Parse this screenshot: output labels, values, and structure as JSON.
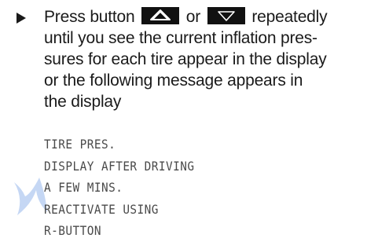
{
  "instruction": {
    "line1_before": "Press button",
    "line1_between": "or",
    "line1_after": "repeatedly",
    "lines": [
      "until you see the current inflation pres-",
      "sures for each tire appear in the display",
      "or the following message appears in",
      "the display"
    ],
    "up_key_icon": "up-arrow-key-icon",
    "down_key_icon": "down-arrow-key-icon"
  },
  "display_message": [
    "TIRE PRES.",
    "DISPLAY AFTER DRIVING",
    "A FEW MINS.",
    "REACTIVATE USING",
    "R-BUTTON"
  ],
  "colors": {
    "text": "#1a1a1a",
    "display_text": "#4a4a4a",
    "key_background": "#111111",
    "key_arrow": "#ffffff",
    "watermark": "#2f6fd6"
  }
}
